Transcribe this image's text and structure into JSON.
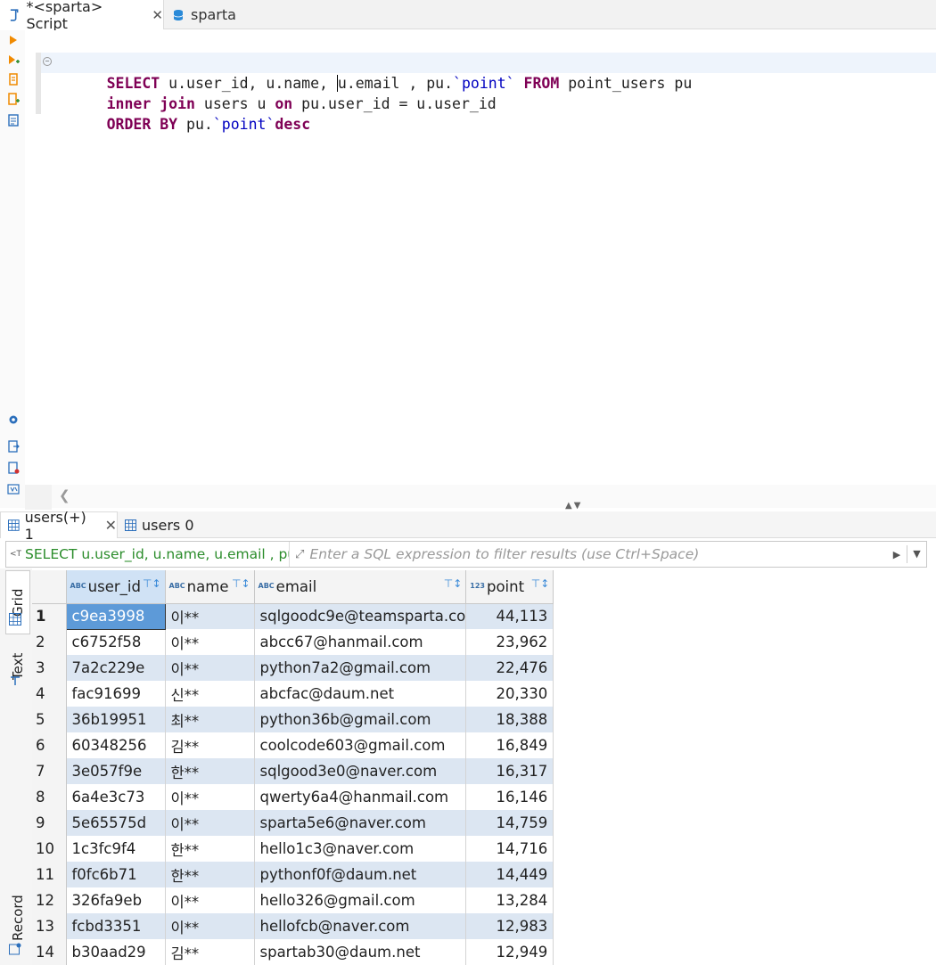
{
  "editor_tabs": [
    {
      "label": "*<sparta> Script",
      "active": true
    },
    {
      "label": "sparta",
      "active": false
    }
  ],
  "sql": {
    "line1": {
      "k1": "SELECT",
      "t1": " u.user_id, u.name, ",
      "t2": "u.email , pu.",
      "id1": "`point`",
      "t3": " ",
      "k2": "FROM",
      "t4": " point_users pu"
    },
    "line2": {
      "k1": "inner join",
      "t1": " users u ",
      "k2": "on",
      "t2": " pu.user_id = u.user_id"
    },
    "line3": {
      "k1": "ORDER BY",
      "t1": " pu.",
      "id1": "`point`",
      "k2": "desc"
    }
  },
  "result_tabs": [
    {
      "label": "users(+) 1",
      "active": true
    },
    {
      "label": "users 0",
      "active": false
    }
  ],
  "filter": {
    "query": "SELECT u.user_id, u.name, u.email , pu",
    "placeholder": "Enter a SQL expression to filter results (use Ctrl+Space)"
  },
  "side_tabs": [
    "Grid",
    "Text",
    "Record"
  ],
  "grid": {
    "columns": [
      {
        "label": "user_id",
        "type": "ABC"
      },
      {
        "label": "name",
        "type": "ABC"
      },
      {
        "label": "email",
        "type": "ABC"
      },
      {
        "label": "point",
        "type": "123"
      }
    ],
    "rows": [
      {
        "n": "1",
        "user_id": "c9ea3998",
        "name": "이**",
        "email": "sqlgoodc9e@teamsparta.co",
        "point": "44,113"
      },
      {
        "n": "2",
        "user_id": "c6752f58",
        "name": "이**",
        "email": "abcc67@hanmail.com",
        "point": "23,962"
      },
      {
        "n": "3",
        "user_id": "7a2c229e",
        "name": "이**",
        "email": "python7a2@gmail.com",
        "point": "22,476"
      },
      {
        "n": "4",
        "user_id": "fac91699",
        "name": "신**",
        "email": "abcfac@daum.net",
        "point": "20,330"
      },
      {
        "n": "5",
        "user_id": "36b19951",
        "name": "최**",
        "email": "python36b@gmail.com",
        "point": "18,388"
      },
      {
        "n": "6",
        "user_id": "60348256",
        "name": "김**",
        "email": "coolcode603@gmail.com",
        "point": "16,849"
      },
      {
        "n": "7",
        "user_id": "3e057f9e",
        "name": "한**",
        "email": "sqlgood3e0@naver.com",
        "point": "16,317"
      },
      {
        "n": "8",
        "user_id": "6a4e3c73",
        "name": "이**",
        "email": "qwerty6a4@hanmail.com",
        "point": "16,146"
      },
      {
        "n": "9",
        "user_id": "5e65575d",
        "name": "이**",
        "email": "sparta5e6@naver.com",
        "point": "14,759"
      },
      {
        "n": "10",
        "user_id": "1c3fc9f4",
        "name": "한**",
        "email": "hello1c3@naver.com",
        "point": "14,716"
      },
      {
        "n": "11",
        "user_id": "f0fc6b71",
        "name": "한**",
        "email": "pythonf0f@daum.net",
        "point": "14,449"
      },
      {
        "n": "12",
        "user_id": "326fa9eb",
        "name": "이**",
        "email": "hello326@gmail.com",
        "point": "13,284"
      },
      {
        "n": "13",
        "user_id": "fcbd3351",
        "name": "이**",
        "email": "hellofcb@naver.com",
        "point": "12,983"
      },
      {
        "n": "14",
        "user_id": "b30aad29",
        "name": "김**",
        "email": "spartab30@daum.net",
        "point": "12,949"
      }
    ]
  },
  "colors": {
    "keyword": "#7f0055",
    "identifier": "#0000c0",
    "row_stripe": "#dce6f2",
    "selected_cell": "#5d9ad8"
  }
}
